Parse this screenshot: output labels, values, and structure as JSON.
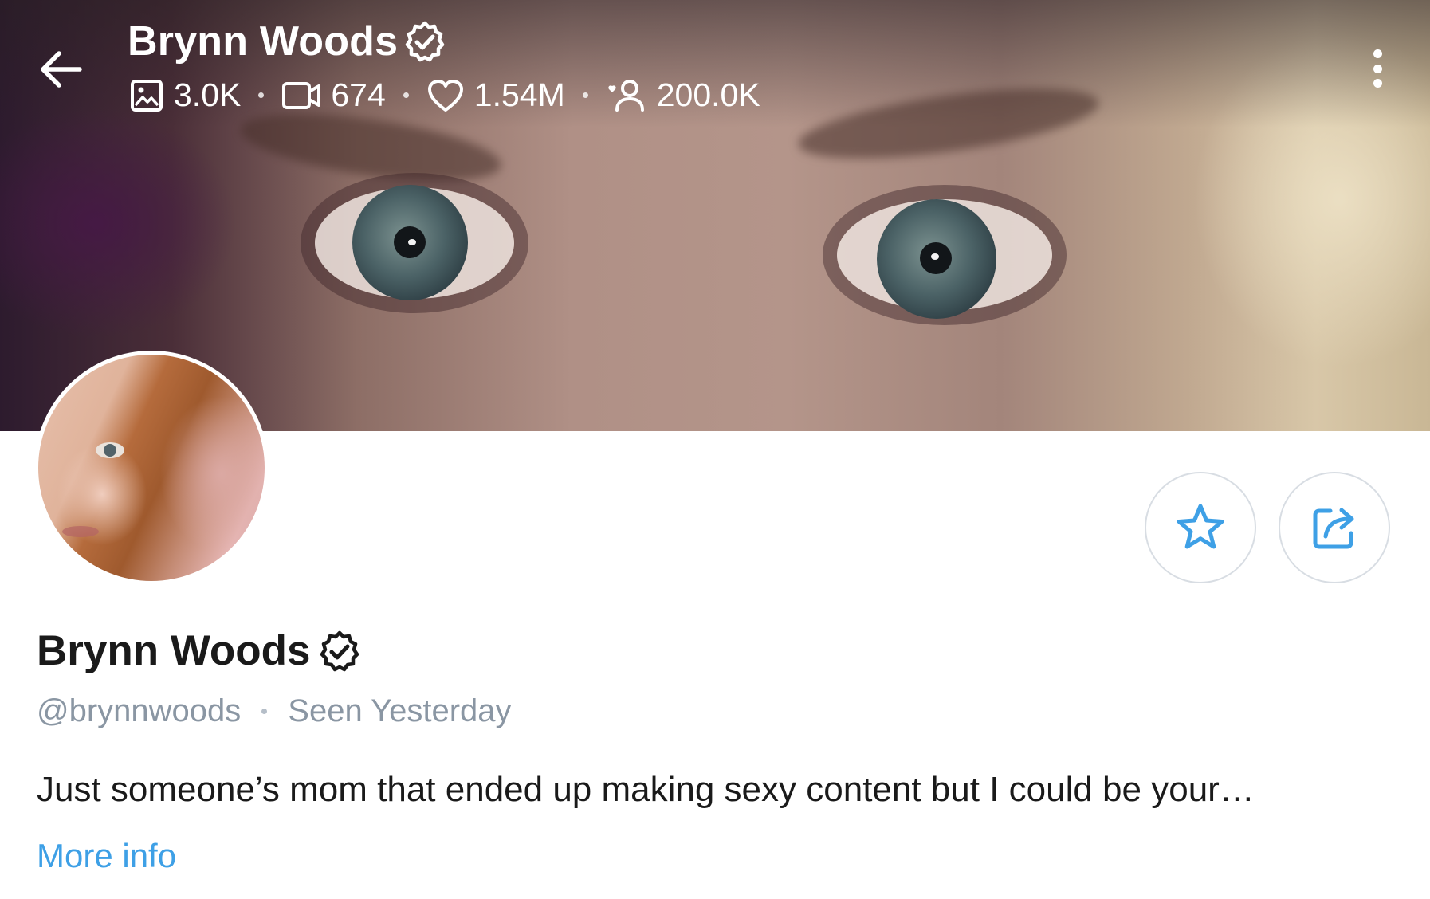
{
  "header": {
    "name": "Brynn Woods",
    "stats": {
      "photos": "3.0K",
      "videos": "674",
      "likes": "1.54M",
      "fans": "200.0K"
    },
    "icons": [
      "back-arrow-icon",
      "verified-badge-icon",
      "image-icon",
      "video-icon",
      "heart-icon",
      "fans-icon",
      "more-vertical-icon"
    ]
  },
  "profile": {
    "name": "Brynn Woods",
    "handle": "@brynnwoods",
    "last_seen": "Seen Yesterday",
    "bio": "Just someone’s mom that ended up making sexy content but I could be your…",
    "more_info": "More info"
  },
  "actions": {
    "icons": [
      "star-icon",
      "share-icon"
    ]
  },
  "colors": {
    "accent": "#3ea0e6",
    "muted_text": "#8a96a3",
    "text": "#1a1a1a",
    "button_border": "#d8dde3"
  }
}
